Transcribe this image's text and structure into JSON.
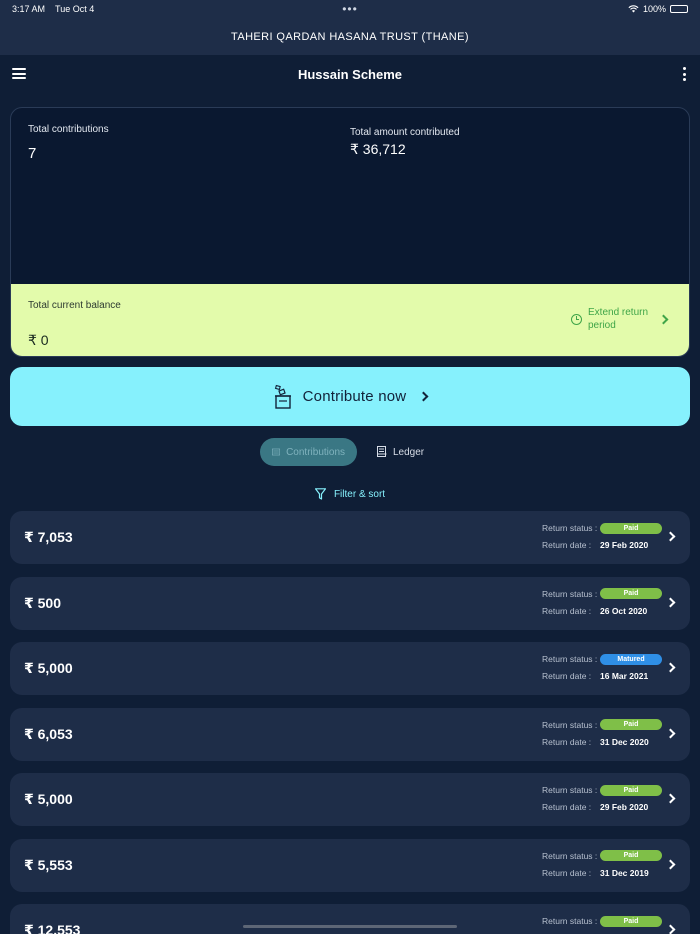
{
  "status_bar": {
    "time": "3:17 AM",
    "date": "Tue Oct 4",
    "battery": "100%"
  },
  "org": {
    "title": "TAHERI QARDAN HASANA TRUST (THANE)"
  },
  "nav": {
    "title": "Hussain Scheme"
  },
  "summary": {
    "total_contributions_label": "Total contributions",
    "total_contributions_value": "7",
    "total_amount_label": "Total amount contributed",
    "total_amount_value": "₹ 36,712",
    "balance_label": "Total current balance",
    "balance_value": "₹ 0",
    "extend_label": "Extend return period"
  },
  "contribute": {
    "label": "Contribute now"
  },
  "tabs": [
    {
      "label": "Contributions",
      "active": true
    },
    {
      "label": "Ledger",
      "active": false
    }
  ],
  "filter": {
    "label": "Filter & sort"
  },
  "labels": {
    "return_status": "Return status :",
    "return_date": "Return date :"
  },
  "contributions": [
    {
      "amount": "₹ 7,053",
      "status": "Paid",
      "date": "29 Feb 2020"
    },
    {
      "amount": "₹ 500",
      "status": "Paid",
      "date": "26 Oct 2020"
    },
    {
      "amount": "₹ 5,000",
      "status": "Matured",
      "date": "16 Mar 2021"
    },
    {
      "amount": "₹ 6,053",
      "status": "Paid",
      "date": "31 Dec 2020"
    },
    {
      "amount": "₹ 5,000",
      "status": "Paid",
      "date": "29 Feb 2020"
    },
    {
      "amount": "₹ 5,553",
      "status": "Paid",
      "date": "31 Dec 2019"
    },
    {
      "amount": "₹ 12,553",
      "status": "Paid",
      "date": ""
    }
  ],
  "colors": {
    "background": "#0f1e36",
    "card": "#1e2d48",
    "accent": "#86f1fd",
    "balance": "#e3fbab",
    "paid": "#7fbf48",
    "matured": "#2f8fe6"
  }
}
